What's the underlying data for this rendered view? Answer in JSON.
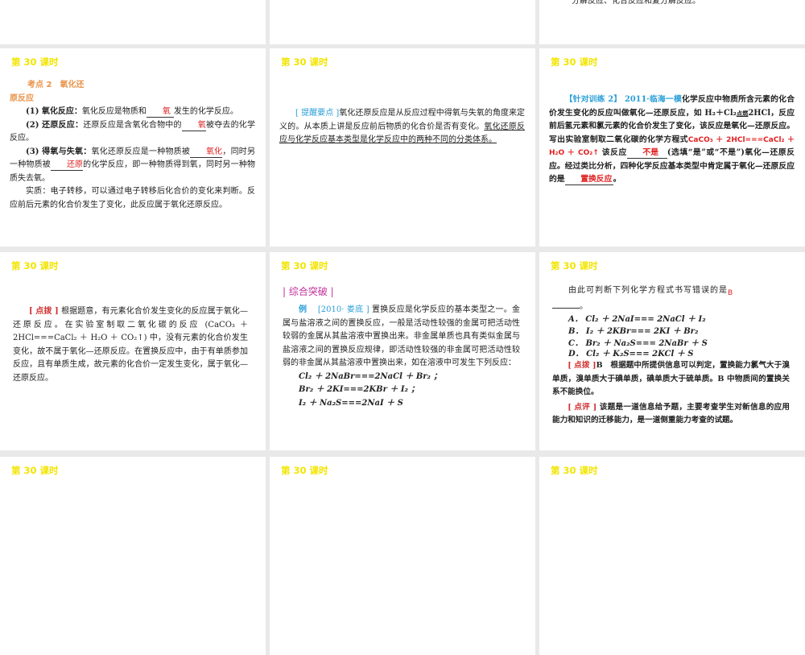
{
  "slide_title": "第 30 课时",
  "top_right_fragment": "分解反应、化合反应和复分解反应。",
  "s1": {
    "heading1": "考点 2　氧化还",
    "heading2": "原反应",
    "p1_label": "(1) 氧化反应：",
    "p1_a": "氧化反应是物质和",
    "p1_blank": "氧",
    "p1_b": "发生的化学反应。",
    "p2_label": "(2) 还原反应：",
    "p2_a": "还原反应是含氧化合物中的",
    "p2_blank": "氧",
    "p2_b": "被夺去的化学反应。",
    "p3_label": "(3) 得氧与失氧：",
    "p3_a": "氧化还原反应是一种物质被",
    "p3_blank1": "氧化",
    "p3_b": "，同时另一种物质被",
    "p3_blank2": "还原",
    "p3_c": "的化学反应，即一种物质得到氧，同时另一种物质失去氧。",
    "p4": "实质：电子转移，可以通过电子转移后化合价的变化来判断。反应前后元素的化合价发生了变化，此反应属于氧化还原反应。"
  },
  "s2": {
    "tag": "[ 提醒要点 ]",
    "text": "氧化还原反应是从反应过程中得氧与失氧的角度来定义的。从本质上讲是反应前后物质的化合价是否有变化。",
    "underlined": "氧化还原反应与化学反应基本类型是化学反应中的两种不同的分类体系。"
  },
  "s3": {
    "tag": "【针对训练 2】",
    "source": "2011·临海一模",
    "t1": "化学反应中物质所含元素的化合价发生变化的反应叫做氧化—还原反应，如 H₂＋Cl₂",
    "cond": "点燃",
    "t2": "2HCl，反应前后氢元素和氯元素的化合价发生了变化，该反应是氧化—还原反应。写出实验室制取二氧化碳的化学方程式",
    "eq": "CaCO₃ ＋ 2HCl===CaCl₂ ＋ H₂O ＋ CO₂↑",
    "t3": "该反应",
    "blank1": "不是",
    "t4": "(选填“是”或“不是”)氧化—还原反应。经过类比分析，四种化学反应基本类型中肯定属于氧化—还原反应的是",
    "blank2": "置换反应",
    "t5": "。"
  },
  "s4": {
    "tag": "[ 点拨 ]",
    "text": "根据题意，有元素化合价发生变化的反应属于氧化—还原反应。在实验室制取二氧化碳的反应 (CaCO₃ ＋ 2HCl===CaCl₂ ＋ H₂O ＋ CO₂↑) 中，没有元素的化合价发生变化，故不属于氧化—还原反应。在置换反应中，由于有单质参加反应，且有单质生成，故元素的化合价一定发生变化，属于氧化—还原反应。"
  },
  "s5": {
    "section": "| 综合突破 |",
    "ex": "例",
    "source": "[2010· 娄底 ]",
    "text": "置换反应是化学反应的基本类型之一。金属与盐溶液之间的置换反应，一般是活动性较强的金属可把活动性较弱的金属从其盐溶液中置换出来。非金属单质也具有类似金属与盐溶液之间的置换反应规律，即活动性较强的非金属可把活动性较弱的非金属从其盐溶液中置换出来，如在溶液中可发生下列反应：",
    "eqs": [
      "Cl₂ ＋ 2NaBr===2NaCl ＋ Br₂ ；",
      "Br₂ ＋ 2KI===2KBr ＋ I₂ ；",
      "I₂ ＋ Na₂S===2NaI ＋ S"
    ]
  },
  "s6": {
    "q": "由此可判断下列化学方程式书写错误的是",
    "answer": "B",
    "options": [
      "A．  Cl₂ ＋ 2NaI=== 2NaCl ＋ I₂",
      "B．  I₂ ＋ 2KBr=== 2KI ＋ Br₂",
      "C．  Br₂ ＋ Na₂S=== 2NaBr ＋ S",
      "D．  Cl₂ ＋ K₂S=== 2KCl ＋ S"
    ],
    "tag1": "[ 点拨 ]",
    "t1": "B　根据题中所提供信息可以判定，置换能力氯气大于溴单质，溴单质大于碘单质，碘单质大于硫单质。B 中物质间的置换关系不能换位。",
    "tag2": "[ 点评 ]",
    "t2": "该题是一道信息给予题，主要考查学生对新信息的应用能力和知识的迁移能力，是一道侧重能力考查的试题。"
  }
}
